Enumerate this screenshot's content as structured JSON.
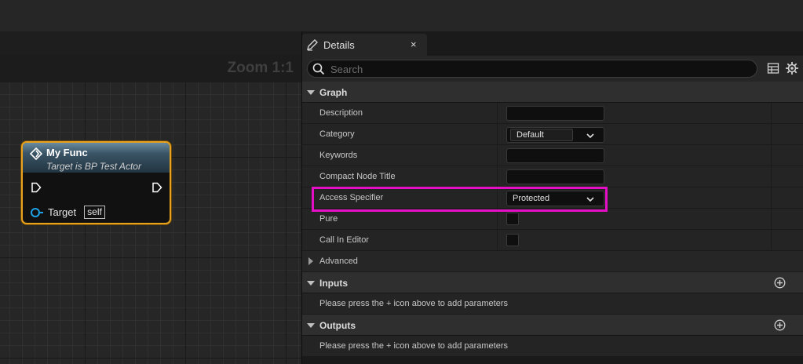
{
  "graph": {
    "zoom_label": "Zoom 1:1",
    "node": {
      "title": "My Func",
      "subtitle": "Target is BP Test Actor",
      "target_label": "Target",
      "self_label": "self"
    }
  },
  "details": {
    "tab_label": "Details",
    "close_glyph": "×",
    "search_placeholder": "Search",
    "graph_section": "Graph",
    "fields": {
      "description": "Description",
      "category": "Category",
      "category_value": "Default",
      "keywords": "Keywords",
      "compact_title": "Compact Node Title",
      "access_specifier": "Access Specifier",
      "access_value": "Protected",
      "pure": "Pure",
      "call_in_editor": "Call In Editor"
    },
    "advanced_section": "Advanced",
    "inputs_section": "Inputs",
    "inputs_hint": "Please press the + icon above to add parameters",
    "outputs_section": "Outputs",
    "outputs_hint": "Please press the + icon above to add parameters"
  },
  "colors": {
    "node_border": "#e8a21d",
    "highlight": "#e40fc4",
    "object_pin": "#1fa3e8"
  }
}
